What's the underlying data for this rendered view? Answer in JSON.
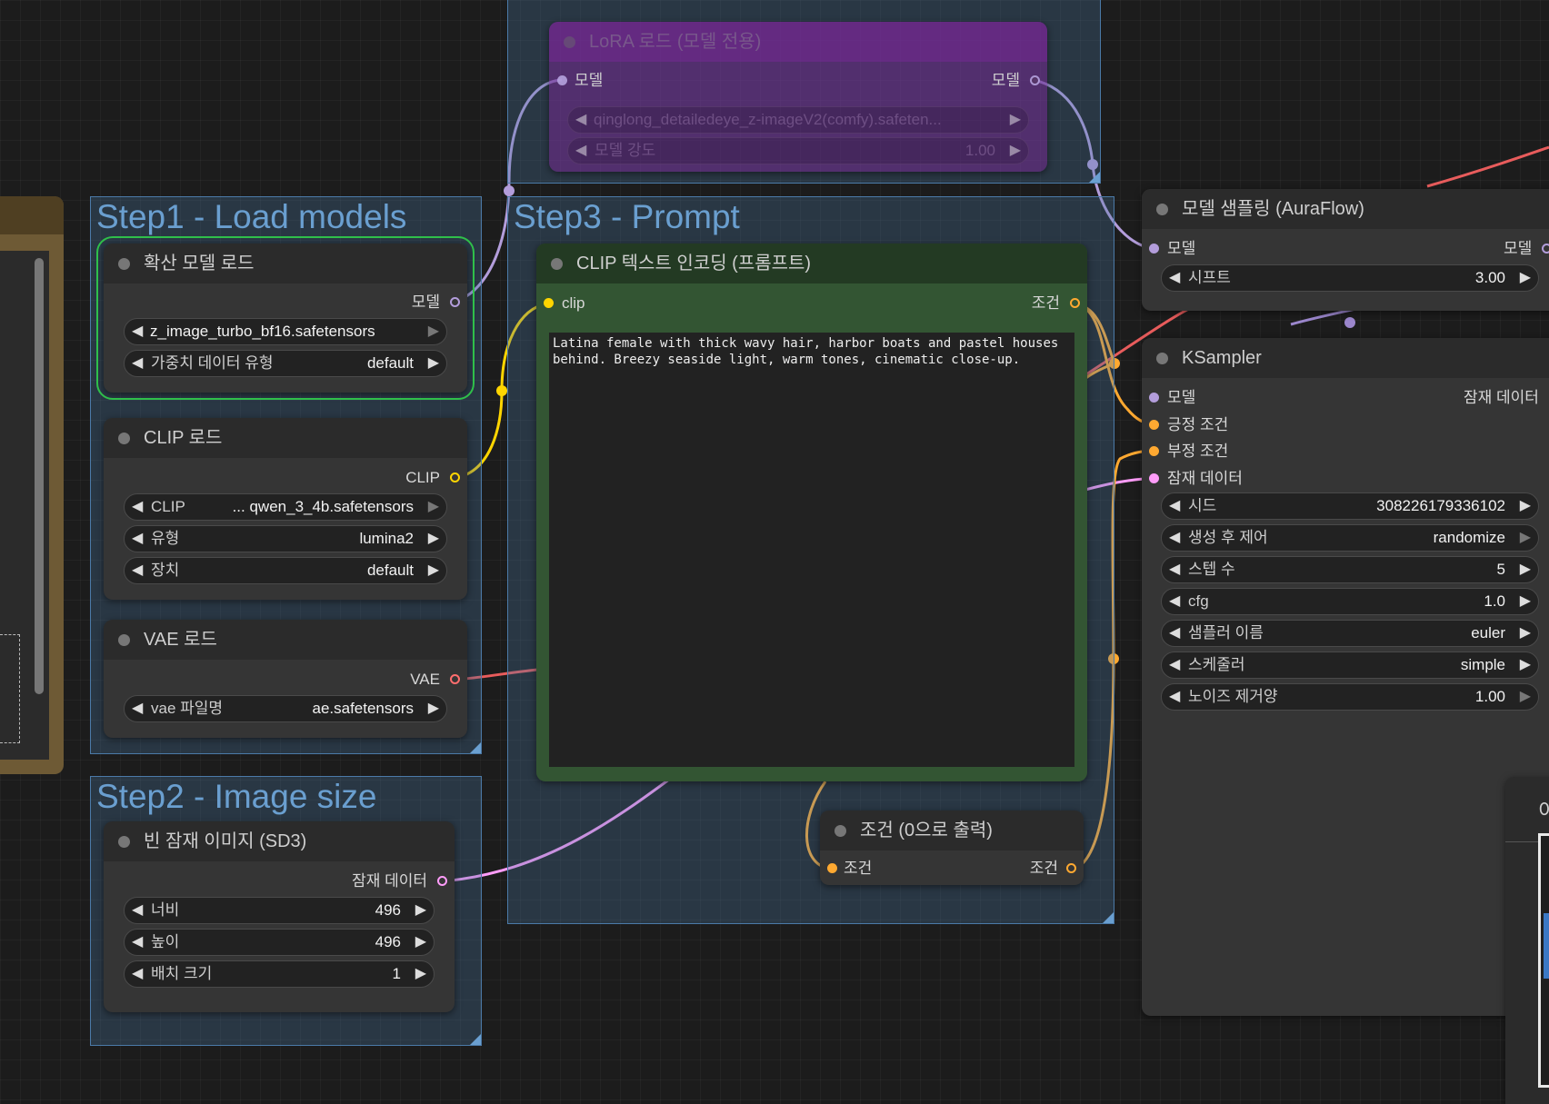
{
  "groups": {
    "step1": {
      "title": "Step1 - Load models"
    },
    "step2": {
      "title": "Step2 - Image size"
    },
    "step3": {
      "title": "Step3 - Prompt"
    }
  },
  "lora_node": {
    "title": "LoRA 로드 (모델 전용)",
    "input_label": "모델",
    "output_label": "모델",
    "lora_name": "qinglong_detailedeye_z-imageV2(comfy).safeten...",
    "strength_label": "모델 강도",
    "strength_value": "1.00"
  },
  "diffusion_node": {
    "title": "확산 모델 로드",
    "output_label": "모델",
    "unet_name": "z_image_turbo_bf16.safetensors",
    "dtype_label": "가중치 데이터 유형",
    "dtype_value": "default"
  },
  "clip_loader_node": {
    "title": "CLIP 로드",
    "output_label": "CLIP",
    "clip_label": "CLIP",
    "clip_value": "... qwen_3_4b.safetensors",
    "type_label": "유형",
    "type_value": "lumina2",
    "device_label": "장치",
    "device_value": "default"
  },
  "vae_node": {
    "title": "VAE 로드",
    "output_label": "VAE",
    "vae_label": "vae 파일명",
    "vae_value": "ae.safetensors"
  },
  "latent_node": {
    "title": "빈 잠재 이미지 (SD3)",
    "output_label": "잠재 데이터",
    "width_label": "너비",
    "width_value": "496",
    "height_label": "높이",
    "height_value": "496",
    "batch_label": "배치 크기",
    "batch_value": "1"
  },
  "clip_text_node": {
    "title": "CLIP 텍스트 인코딩 (프롬프트)",
    "input_label": "clip",
    "output_label": "조건",
    "prompt_text": "Latina female with thick wavy hair, harbor boats and pastel houses behind. Breezy seaside light, warm tones, cinematic close-up."
  },
  "zero_cond_node": {
    "title": "조건 (0으로 출력)",
    "input_label": "조건",
    "output_label": "조건"
  },
  "auraflow_node": {
    "title": "모델 샘플링 (AuraFlow)",
    "input_label": "모델",
    "output_label": "모델",
    "shift_label": "시프트",
    "shift_value": "3.00"
  },
  "ksampler_node": {
    "title": "KSampler",
    "inputs": {
      "model": "모델",
      "positive": "긍정 조건",
      "negative": "부정 조건",
      "latent": "잠재 데이터"
    },
    "output_label": "잠재 데이터",
    "seed_label": "시드",
    "seed_value": "308226179336102",
    "control_label": "생성 후 제어",
    "control_value": "randomize",
    "steps_label": "스텝 수",
    "steps_value": "5",
    "cfg_label": "cfg",
    "cfg_value": "1.0",
    "sampler_label": "샘플러 이름",
    "sampler_value": "euler",
    "scheduler_label": "스케줄러",
    "scheduler_value": "simple",
    "denoise_label": "노이즈 제거양",
    "denoise_value": "1.00"
  },
  "partial_right_node": {
    "title_fragment": "이"
  },
  "colors": {
    "model": "#b39ddb",
    "clip": "#ffd500",
    "conditioning": "#ffa931",
    "vae": "#ff6e6e",
    "latent": "#ff9cf9",
    "group_fill": "#4a78a3",
    "clip_node_fill": "#335533",
    "lora_node_fill": "#553366"
  }
}
